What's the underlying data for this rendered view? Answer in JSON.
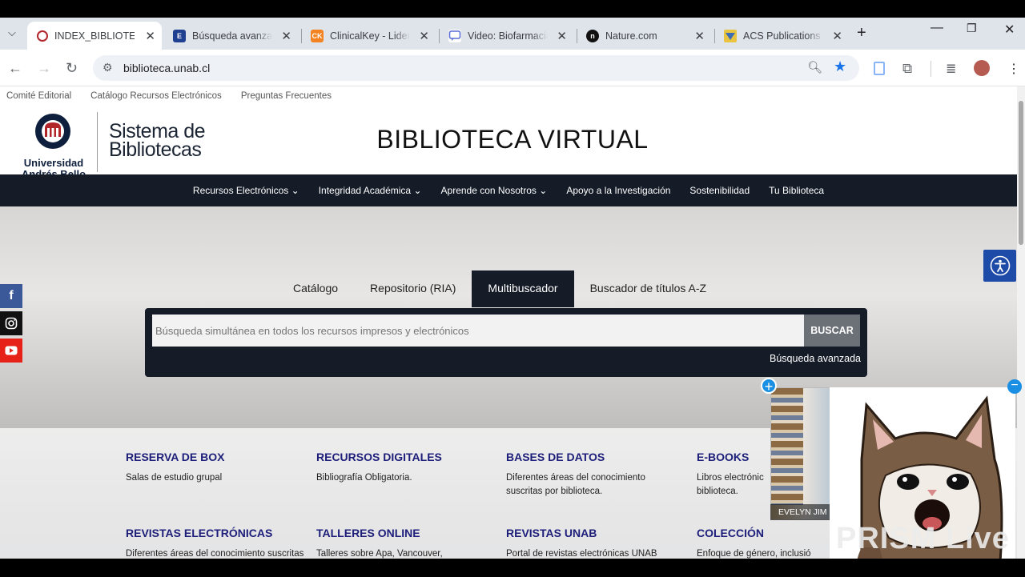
{
  "browser": {
    "tabs": [
      {
        "label": "INDEX_BIBLIOTECA",
        "active": true
      },
      {
        "label": "Búsqueda avanzada",
        "active": false
      },
      {
        "label": "ClinicalKey - Lidera",
        "active": false
      },
      {
        "label": "Video: Biofarmacia",
        "active": false
      },
      {
        "label": "Nature.com",
        "active": false
      },
      {
        "label": "ACS Publications |",
        "active": false
      }
    ],
    "url": "biblioteca.unab.cl",
    "fav_ck": "CK",
    "fav_e": "E"
  },
  "page": {
    "util_links": [
      "Comité Editorial",
      "Catálogo Recursos Electrónicos",
      "Preguntas Frecuentes"
    ],
    "logo_lines": [
      "Universidad",
      "Andrés Bello"
    ],
    "sistema": [
      "Sistema de",
      "Bibliotecas"
    ],
    "title": "BIBLIOTECA VIRTUAL",
    "nav": [
      "Recursos Electrónicos",
      "Integridad Académica",
      "Aprende con Nosotros",
      "Apoyo a la Investigación",
      "Sostenibilidad",
      "Tu Biblioteca"
    ],
    "search_tabs": [
      "Catálogo",
      "Repositorio (RIA)",
      "Multibuscador",
      "Buscador de títulos A-Z"
    ],
    "search_placeholder": "Búsqueda simultánea en todos los recursos impresos y electrónicos",
    "search_button": "BUSCAR",
    "advanced_link": "Búsqueda avanzada",
    "cards": [
      {
        "title": "RESERVA DE BOX",
        "desc": "Salas de estudio grupal"
      },
      {
        "title": "RECURSOS DIGITALES",
        "desc": "Bibliografía Obligatoria."
      },
      {
        "title": "BASES DE DATOS",
        "desc": "Diferentes áreas del conocimiento suscritas por biblioteca."
      },
      {
        "title": "E-BOOKS",
        "desc": "Libros electrónic biblioteca."
      },
      {
        "title": "REVISTAS ELECTRÓNICAS",
        "desc": "Diferentes áreas del conocimiento suscritas por biblioteca."
      },
      {
        "title": "TALLERES ONLINE",
        "desc": "Talleres sobre Apa, Vancouver, Trabajos de Titulación, etc."
      },
      {
        "title": "REVISTAS UNAB",
        "desc": "Portal de revistas electrónicas UNAB"
      },
      {
        "title": "COLECCIÓN",
        "desc": "Enfoque de género, inclusió"
      }
    ]
  },
  "overlay": {
    "cam_name": "EVELYN JIM",
    "watermark": "PRISM Live"
  },
  "colors": {
    "navy": "#151c28",
    "card_title": "#1d1e7a",
    "accent_blue": "#1a73e8"
  }
}
